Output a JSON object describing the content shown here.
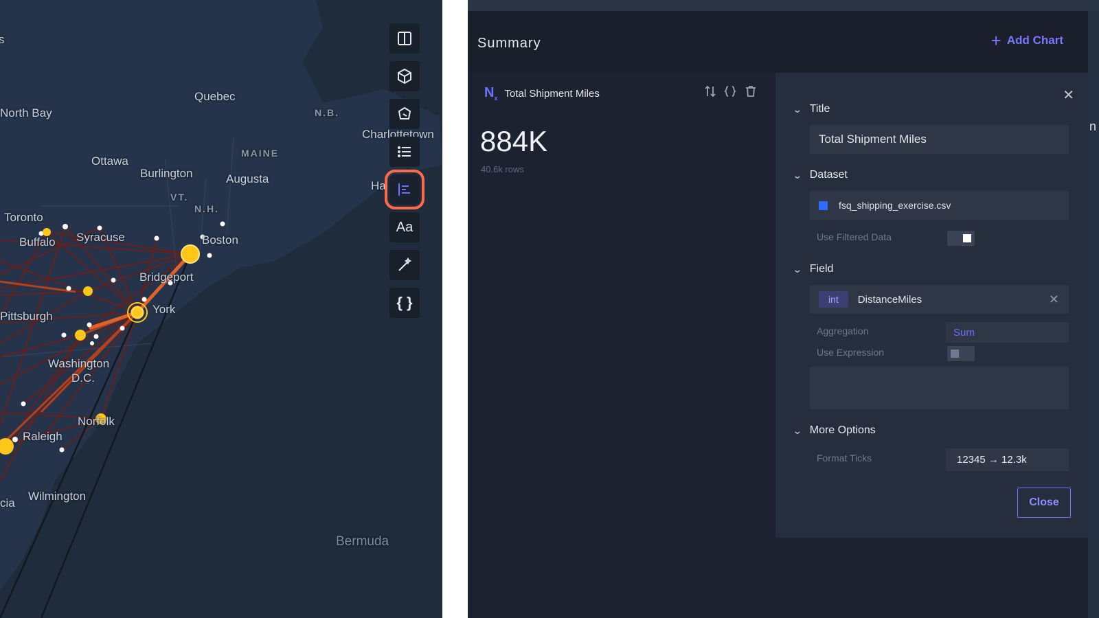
{
  "map": {
    "labels": {
      "north_bay": "North Bay",
      "quebec": "Quebec",
      "nb": "N.B.",
      "charlottetown": "Charlottetown",
      "ottawa": "Ottawa",
      "maine": "MAINE",
      "burlington": "Burlington",
      "augusta": "Augusta",
      "ha": "Ha",
      "vt": "VT.",
      "nh": "N.H.",
      "toronto": "Toronto",
      "buffalo": "Buffalo",
      "syracuse": "Syracuse",
      "boston": "Boston",
      "bridgeport": "Bridgeport",
      "new_york": "York",
      "pittsburgh": "Pittsburgh",
      "washington": "Washington",
      "dc": "D.C.",
      "norfolk": "Norfolk",
      "raleigh": "Raleigh",
      "wilmington": "Wilmington",
      "cia": "cia",
      "bermuda": "Bermuda",
      "s": "s",
      "n": "n"
    },
    "toolbar_icons": [
      "split-map-icon",
      "3d-cube-icon",
      "draw-polygon-icon",
      "layer-list-icon",
      "summary-chart-icon",
      "text-icon",
      "magic-wand-icon",
      "code-braces-icon"
    ],
    "text_tool_label": "Aa",
    "code_tool_label": "{ }",
    "accent_highlight": "#ff6a4a"
  },
  "panel": {
    "title": "Summary",
    "add_chart_label": "Add Chart",
    "card": {
      "title": "Total Shipment Miles",
      "value": "884K",
      "rows": "40.6k rows"
    },
    "config": {
      "title_section": "Title",
      "title_value": "Total Shipment Miles",
      "dataset_section": "Dataset",
      "dataset_name": "fsq_shipping_exercise.csv",
      "dataset_color": "#2d6bff",
      "use_filtered_label": "Use Filtered Data",
      "use_filtered_on": true,
      "field_section": "Field",
      "field_type": "int",
      "field_name": "DistanceMiles",
      "aggregation_label": "Aggregation",
      "aggregation_value": "Sum",
      "use_expression_label": "Use Expression",
      "use_expression_on": false,
      "more_options_section": "More Options",
      "format_ticks_label": "Format Ticks",
      "format_ticks_value": "12345 → 12.3k",
      "close_label": "Close"
    },
    "accent_color": "#7a78ff"
  }
}
